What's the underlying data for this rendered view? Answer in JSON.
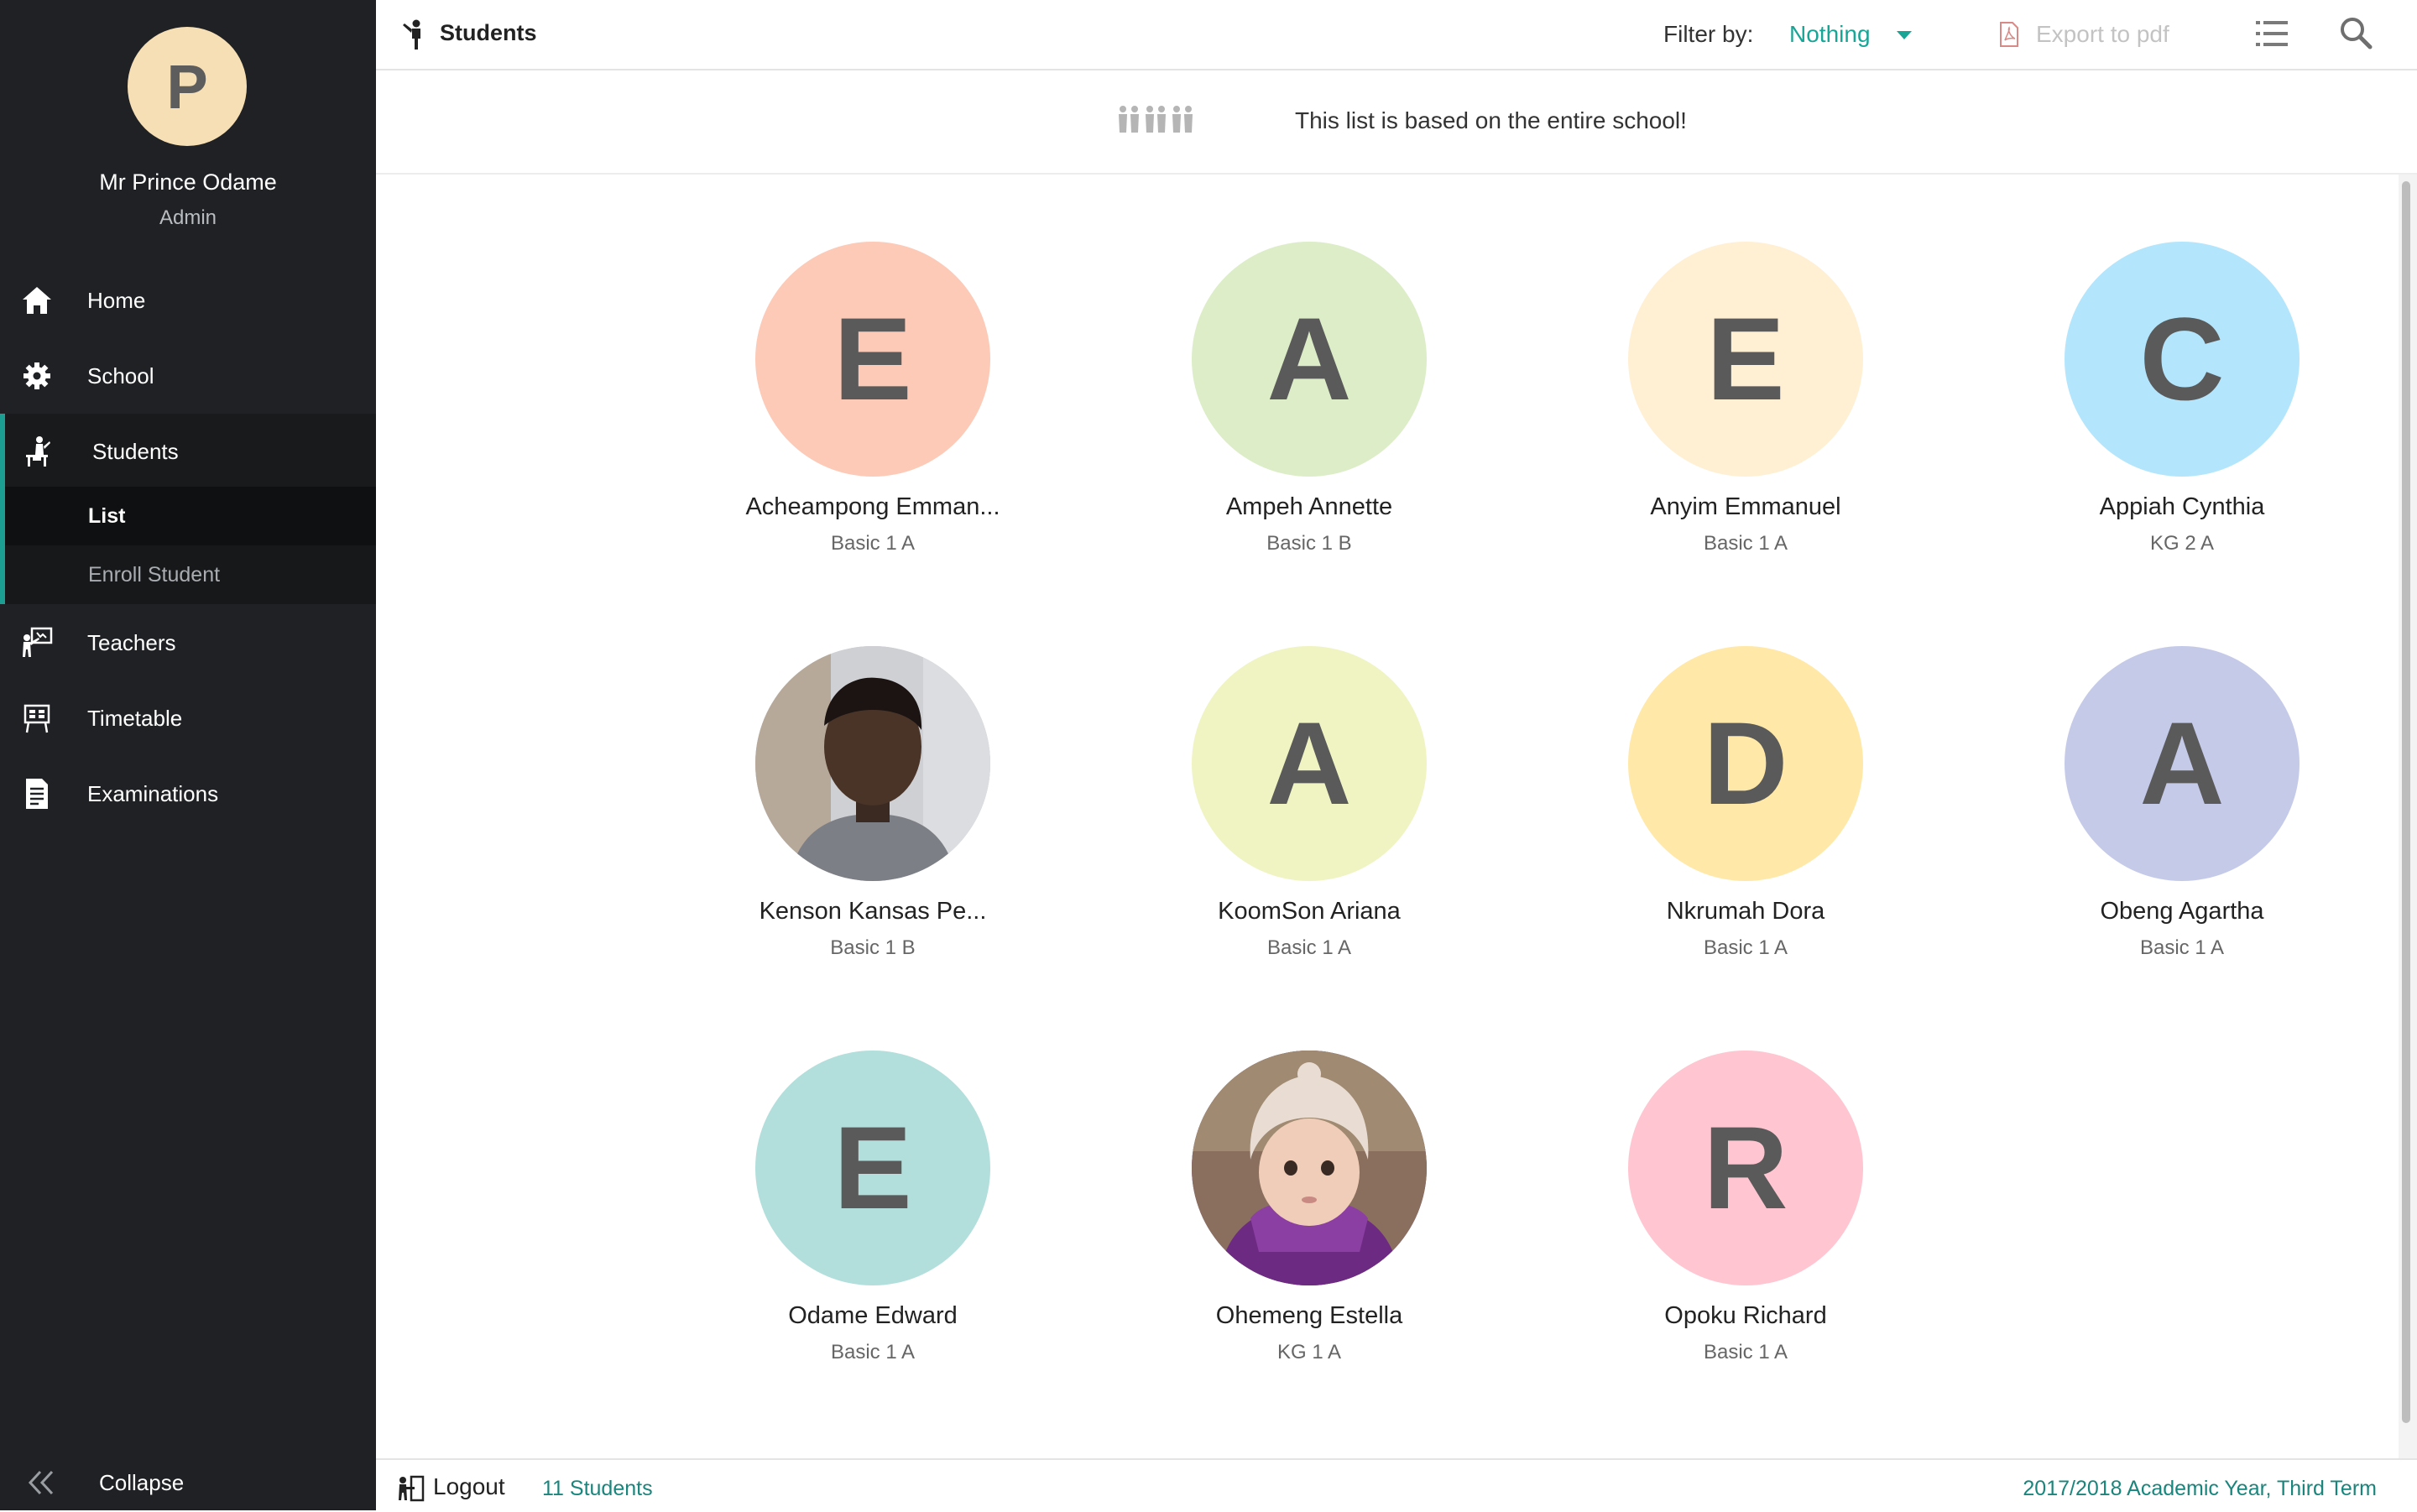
{
  "sidebar": {
    "avatar_letter": "P",
    "user_name": "Mr Prince Odame",
    "user_role": "Admin",
    "nav": [
      {
        "label": "Home",
        "icon": "home-icon"
      },
      {
        "label": "School",
        "icon": "gear-icon"
      },
      {
        "label": "Students",
        "icon": "student-desk-icon"
      },
      {
        "label": "Teachers",
        "icon": "teacher-board-icon"
      },
      {
        "label": "Timetable",
        "icon": "timetable-icon"
      },
      {
        "label": "Examinations",
        "icon": "exam-sheet-icon"
      }
    ],
    "sub_nav": [
      {
        "label": "List"
      },
      {
        "label": "Enroll Student"
      }
    ],
    "collapse_label": "Collapse"
  },
  "header": {
    "title": "Students",
    "title_icon": "student-figure-icon",
    "filter_label": "Filter by:",
    "filter_value": "Nothing",
    "export_label": "Export to pdf"
  },
  "banner": {
    "text": "This list is based on the entire school!",
    "icon": "students-group-icon"
  },
  "students": [
    {
      "name": "Acheampong Emman...",
      "class": "Basic 1 A",
      "letter": "E",
      "color": "#fccab7"
    },
    {
      "name": "Ampeh Annette",
      "class": "Basic 1 B",
      "letter": "A",
      "color": "#dcedc8"
    },
    {
      "name": "Anyim Emmanuel",
      "class": "Basic 1 A",
      "letter": "E",
      "color": "#fff0d4"
    },
    {
      "name": "Appiah Cynthia",
      "class": "KG 2 A",
      "letter": "C",
      "color": "#b3e5fc"
    },
    {
      "name": "Kenson Kansas Pe...",
      "class": "Basic 1 B",
      "letter": "",
      "color": "#6f6e73",
      "photo": "boy-photo"
    },
    {
      "name": "KoomSon Ariana",
      "class": "Basic 1 A",
      "letter": "A",
      "color": "#f0f4c3"
    },
    {
      "name": "Nkrumah Dora",
      "class": "Basic 1 A",
      "letter": "D",
      "color": "#ffe8a8"
    },
    {
      "name": "Obeng Agartha",
      "class": "Basic 1 A",
      "letter": "A",
      "color": "#c5cae9"
    },
    {
      "name": "Odame Edward",
      "class": "Basic 1 A",
      "letter": "E",
      "color": "#b2dfdb"
    },
    {
      "name": "Ohemeng Estella",
      "class": "KG 1 A",
      "letter": "",
      "color": "#7b3b8c",
      "photo": "girl-photo"
    },
    {
      "name": "Opoku Richard",
      "class": "Basic 1 A",
      "letter": "R",
      "color": "#ffc5d0"
    }
  ],
  "footer": {
    "logout_label": "Logout",
    "student_count": "11 Students",
    "term": "2017/2018 Academic Year,  Third Term"
  },
  "colors": {
    "accent": "#19a596",
    "sidebar_bg": "#1f2124"
  }
}
